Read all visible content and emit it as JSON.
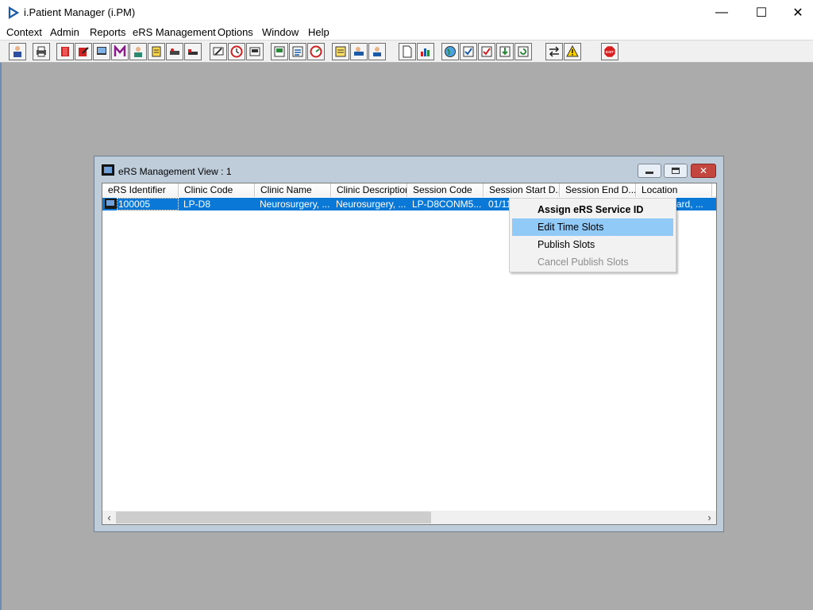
{
  "window": {
    "title": "i.Patient Manager (i.PM)",
    "controls": {
      "minimize": "—",
      "maximize": "☐",
      "close": "✕"
    }
  },
  "menu": [
    "Context",
    "Admin",
    "Reports",
    "eRS Management",
    "Options",
    "Window",
    "Help"
  ],
  "toolbar": {
    "buttons": [
      "person-icon",
      "printer-icon",
      "book-icon",
      "edit-icon",
      "monitor-icon",
      "m-icon",
      "doctor-icon",
      "notes-icon",
      "ward-icon",
      "bed-icon",
      "scan-icon",
      "clock-icon",
      "screen-icon",
      "report-icon",
      "list-icon",
      "gauge-icon",
      "note-icon",
      "transfer-icon",
      "admit-icon",
      "document-icon",
      "chart-icon",
      "globe-icon",
      "check-list-icon",
      "task-icon",
      "download-icon",
      "refresh-icon",
      "swap-icon",
      "warning-icon",
      "exit-icon"
    ],
    "exit_label": "EXIT"
  },
  "child_window": {
    "title": "eRS Management View : 1",
    "columns": [
      "eRS Identifier",
      "Clinic Code",
      "Clinic Name",
      "Clinic Description",
      "Session Code",
      "Session Start D...",
      "Session End D...",
      "Location"
    ],
    "rows": [
      {
        "ers_identifier": "100005",
        "clinic_code": "LP-D8",
        "clinic_name": "Neurosurgery, ...",
        "clinic_description": "Neurosurgery, ...",
        "session_code": "LP-D8CONM5...",
        "session_start": "01/11",
        "session_end": "",
        "location": "Ward, ..."
      }
    ]
  },
  "context_menu": {
    "items": [
      {
        "label": "Assign eRS Service ID",
        "style": "bold"
      },
      {
        "label": "Edit Time Slots",
        "style": "hover"
      },
      {
        "label": "Publish Slots",
        "style": "normal"
      },
      {
        "label": "Cancel Publish Slots",
        "style": "disabled"
      }
    ]
  }
}
